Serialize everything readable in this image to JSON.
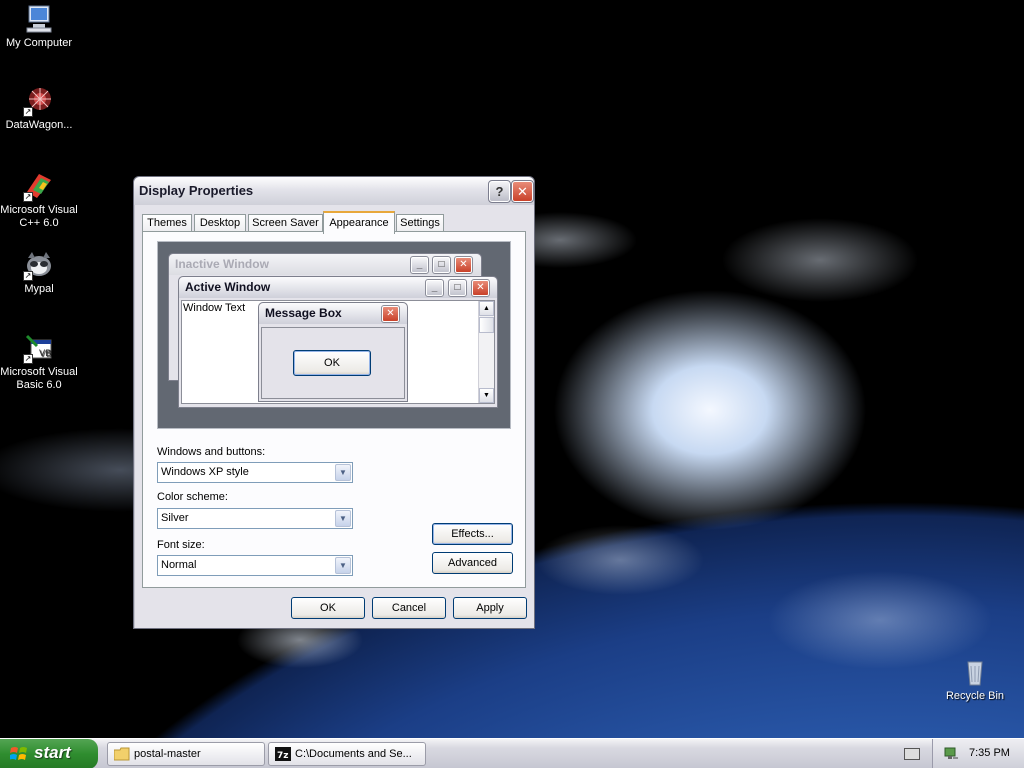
{
  "desktop_icons": [
    {
      "label": "My Computer",
      "icon": "computer-icon"
    },
    {
      "label": "DataWagon...",
      "icon": "datawagon-icon"
    },
    {
      "label": "Microsoft Visual C++ 6.0",
      "icon": "visual-cpp-icon"
    },
    {
      "label": "Mypal",
      "icon": "mypal-icon"
    },
    {
      "label": "Microsoft Visual Basic 6.0",
      "icon": "visual-basic-icon"
    },
    {
      "label": "Recycle Bin",
      "icon": "recycle-bin-icon"
    }
  ],
  "dialog": {
    "title": "Display Properties",
    "help_label": "?",
    "close_label": "✕",
    "tabs": [
      "Themes",
      "Desktop",
      "Screen Saver",
      "Appearance",
      "Settings"
    ],
    "active_tab": "Appearance",
    "preview": {
      "inactive_title": "Inactive Window",
      "active_title": "Active Window",
      "window_text": "Window Text",
      "message_title": "Message Box",
      "message_ok": "OK"
    },
    "windows_buttons": {
      "label": "Windows and buttons:",
      "value": "Windows XP style"
    },
    "color_scheme": {
      "label": "Color scheme:",
      "value": "Silver"
    },
    "font_size": {
      "label": "Font size:",
      "value": "Normal"
    },
    "effects_label": "Effects...",
    "advanced_label": "Advanced",
    "ok_label": "OK",
    "cancel_label": "Cancel",
    "apply_label": "Apply"
  },
  "taskbar": {
    "start_label": "start",
    "tasks": [
      {
        "label": "postal-master",
        "icon": "folder-icon"
      },
      {
        "label": "C:\\Documents and Se...",
        "icon": "7zip-icon"
      }
    ],
    "clock": "7:35 PM"
  },
  "colors": {
    "start_green": "#2f8d2f",
    "close_red": "#c9412a",
    "active_tab_accent": "#e8a83b"
  }
}
